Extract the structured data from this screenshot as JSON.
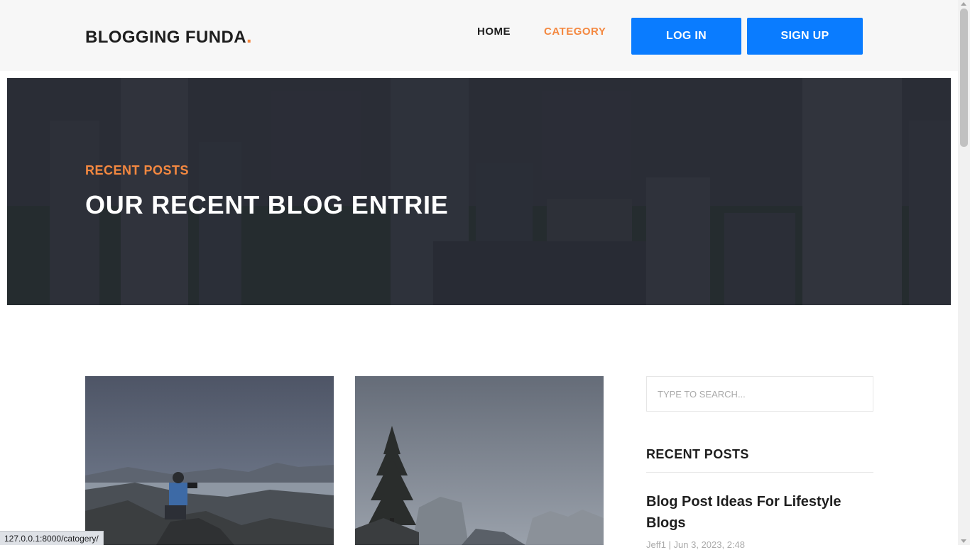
{
  "header": {
    "logo_text": "BLOGGING FUNDA",
    "logo_dot": ".",
    "nav": {
      "home": "HOME",
      "category": "CATEGORY"
    },
    "login_label": "LOG IN",
    "signup_label": "SIGN UP"
  },
  "hero": {
    "kicker": "RECENT POSTS",
    "title": "OUR RECENT BLOG ENTRIE"
  },
  "sidebar": {
    "search_placeholder": "TYPE TO SEARCH...",
    "heading": "RECENT POSTS",
    "posts": [
      {
        "title": "Blog Post Ideas For Lifestyle Blogs",
        "meta": "Jeff1 | Jun 3, 2023, 2:48"
      }
    ]
  },
  "status_bar": {
    "url": "127.0.0.1:8000/catogery/"
  },
  "colors": {
    "accent_orange": "#f48840",
    "button_blue": "#0a7cff",
    "text_dark": "#1e1e1e"
  }
}
